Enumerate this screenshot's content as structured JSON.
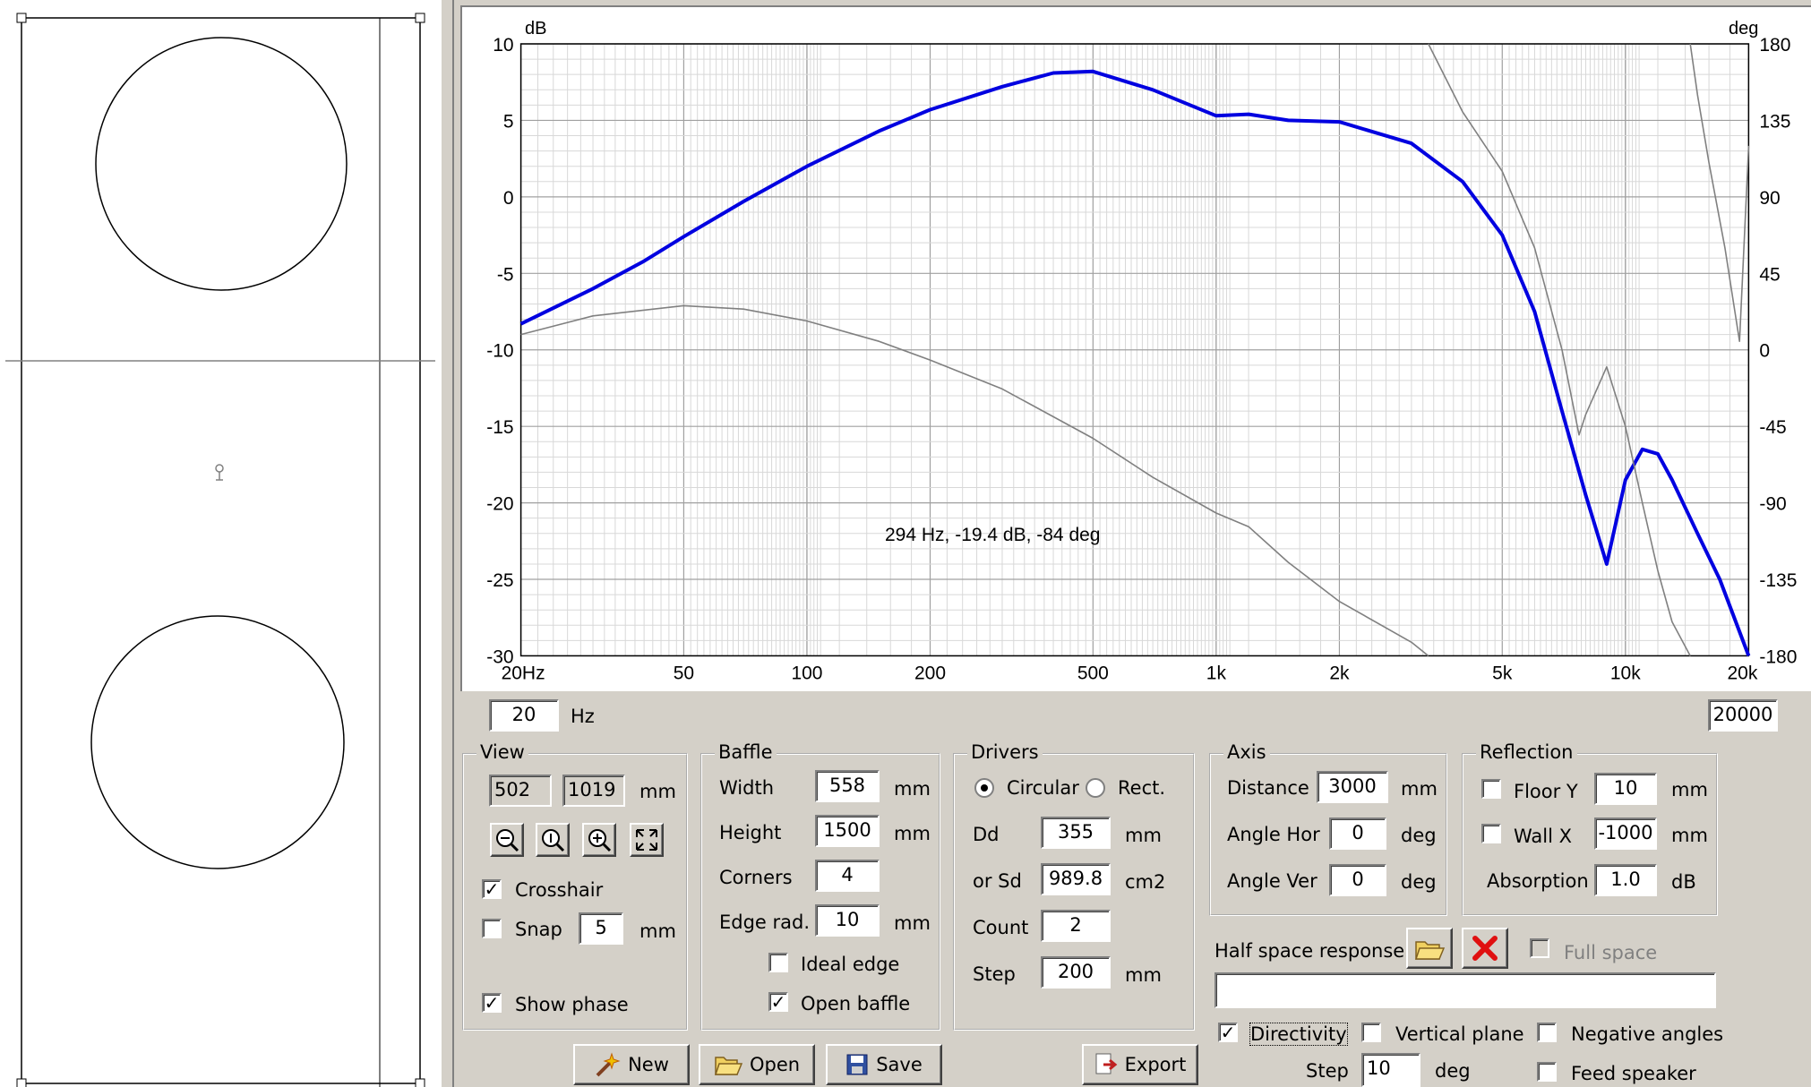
{
  "chart": {
    "y_left_unit": "dB",
    "y_right_unit": "deg",
    "y_left_ticks": [
      "10",
      "5",
      "0",
      "-5",
      "-10",
      "-15",
      "-20",
      "-25",
      "-30"
    ],
    "y_right_ticks": [
      "180",
      "135",
      "90",
      "45",
      "0",
      "-45",
      "-90",
      "-135",
      "-180"
    ],
    "x_ticks": [
      "20Hz",
      "50",
      "100",
      "200",
      "500",
      "1k",
      "2k",
      "5k",
      "10k",
      "20k"
    ],
    "cursor_readout": "294 Hz, -19.4 dB, -84 deg",
    "colors": {
      "magnitude": "#0000e0",
      "phase": "#808080",
      "grid": "#c0c0c0"
    }
  },
  "chart_data": {
    "type": "line",
    "xscale": "log",
    "xlim": [
      20,
      20000
    ],
    "ylim": [
      -30,
      10
    ],
    "ylim_right": [
      -180,
      180
    ],
    "series": [
      {
        "axis": "left",
        "x": [
          20,
          30,
          40,
          50,
          70,
          100,
          150,
          200,
          300,
          400,
          500,
          700,
          1000,
          1200,
          1500,
          2000,
          3000,
          4000,
          5000,
          6000,
          7000,
          8000,
          9000,
          10000,
          11000,
          12000,
          13000,
          15000,
          17000,
          20000
        ],
        "y": [
          -8.3,
          -6.0,
          -4.2,
          -2.6,
          -0.3,
          2.0,
          4.3,
          5.7,
          7.2,
          8.1,
          8.2,
          7.0,
          5.3,
          5.4,
          5.0,
          4.9,
          3.5,
          1.0,
          -2.5,
          -7.5,
          -14,
          -19.5,
          -24,
          -18.5,
          -16.5,
          -16.8,
          -18.5,
          -22,
          -25,
          -30
        ]
      },
      {
        "axis": "right",
        "x": [
          20,
          30,
          50,
          70,
          100,
          150,
          200,
          300,
          500,
          700,
          1000,
          1200,
          1500,
          2000,
          3000,
          3300
        ],
        "y": [
          9,
          20,
          26,
          24,
          17,
          5,
          -6,
          -23,
          -52,
          -75,
          -96,
          -104,
          -125,
          -148,
          -172,
          -180
        ]
      },
      {
        "axis": "right",
        "x": [
          3300,
          4000,
          5000,
          6000,
          7000,
          7700,
          8000,
          9000,
          10000,
          11000,
          12000,
          13000,
          14400
        ],
        "y": [
          180,
          140,
          105,
          60,
          0,
          -50,
          -38,
          -10,
          -45,
          -90,
          -130,
          -160,
          -180
        ]
      },
      {
        "axis": "right",
        "x": [
          14400,
          15000,
          16000,
          17500,
          19000,
          20000
        ],
        "y": [
          180,
          150,
          110,
          60,
          5,
          120
        ]
      }
    ]
  },
  "range": {
    "min_value": "20",
    "min_unit": "Hz",
    "max_value": "20000"
  },
  "view": {
    "title": "View",
    "dim1": "502",
    "dim2": "1019",
    "unit": "mm",
    "crosshair_label": "Crosshair",
    "snap_label": "Snap",
    "snap_value": "5",
    "snap_unit": "mm",
    "show_phase_label": "Show phase"
  },
  "baffle": {
    "title": "Baffle",
    "width_label": "Width",
    "width_value": "558",
    "width_unit": "mm",
    "height_label": "Height",
    "height_value": "1500",
    "height_unit": "mm",
    "corners_label": "Corners",
    "corners_value": "4",
    "edge_label": "Edge rad.",
    "edge_value": "10",
    "edge_unit": "mm",
    "ideal_edge_label": "Ideal edge",
    "open_baffle_label": "Open baffle"
  },
  "drivers": {
    "title": "Drivers",
    "circular_label": "Circular",
    "rect_label": "Rect.",
    "dd_label": "Dd",
    "dd_value": "355",
    "dd_unit": "mm",
    "sd_label": "or Sd",
    "sd_value": "989.8",
    "sd_unit": "cm2",
    "count_label": "Count",
    "count_value": "2",
    "step_label": "Step",
    "step_value": "200",
    "step_unit": "mm"
  },
  "axis": {
    "title": "Axis",
    "distance_label": "Distance",
    "distance_value": "3000",
    "distance_unit": "mm",
    "hor_label": "Angle Hor",
    "hor_value": "0",
    "hor_unit": "deg",
    "ver_label": "Angle Ver",
    "ver_value": "0",
    "ver_unit": "deg"
  },
  "reflection": {
    "title": "Reflection",
    "floor_label": "Floor Y",
    "floor_value": "10",
    "floor_unit": "mm",
    "wall_label": "Wall  X",
    "wall_value": "-1000",
    "wall_unit": "mm",
    "absorption_label": "Absorption",
    "absorption_value": "1.0",
    "absorption_unit": "dB"
  },
  "half_space": {
    "label": "Half space response",
    "full_space_label": "Full space",
    "file_value": ""
  },
  "options": {
    "directivity_label": "Directivity",
    "vertical_plane_label": "Vertical plane",
    "negative_angles_label": "Negative angles",
    "feed_speaker_label": "Feed speaker",
    "step_label": "Step",
    "step_value": "10",
    "step_unit": "deg"
  },
  "buttons": {
    "new": "New",
    "open": "Open",
    "save": "Save",
    "export": "Export"
  }
}
